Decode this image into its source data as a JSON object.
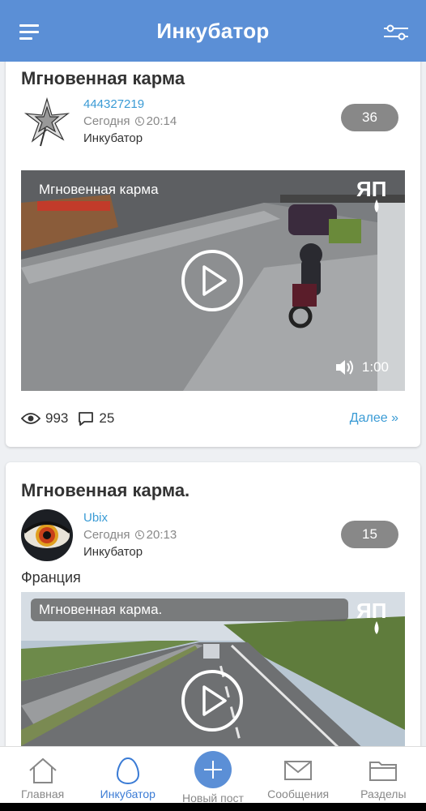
{
  "header": {
    "title": "Инкубатор",
    "menu_icon": "hamburger-icon",
    "filter_icon": "sliders-icon"
  },
  "posts": [
    {
      "title": "Мгновенная карма",
      "author": "444327219",
      "date": "Сегодня",
      "time": "20:14",
      "section": "Инкубатор",
      "rating": "36",
      "text": "",
      "video_title": "Мгновенная карма",
      "duration": "1:00",
      "views": "993",
      "comments": "25",
      "more": "Далее »"
    },
    {
      "title": "Мгновенная карма.",
      "author": "Ubix",
      "date": "Сегодня",
      "time": "20:13",
      "section": "Инкубатор",
      "rating": "15",
      "text": "Франция",
      "video_title": "Мгновенная карма."
    }
  ],
  "nav": {
    "home": "Главная",
    "incubator": "Инкубатор",
    "new_post": "Новый пост",
    "messages": "Сообщения",
    "sections": "Разделы"
  },
  "colors": {
    "accent": "#5b8fd6",
    "link": "#3a9bd5",
    "rating_badge": "#888888"
  }
}
